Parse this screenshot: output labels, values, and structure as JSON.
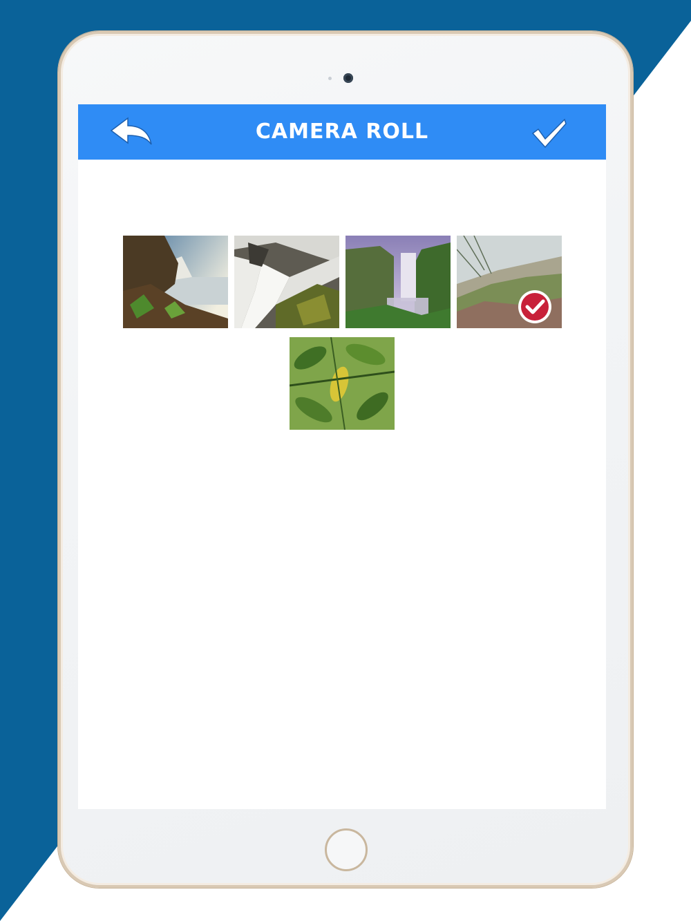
{
  "colors": {
    "background_accent": "#0a6299",
    "topbar": "#2f8cf5",
    "title_text": "#ffffff",
    "device_frame": "#d9c9b4",
    "selected_badge": "#c8213a"
  },
  "header": {
    "title": "CAMERA ROLL",
    "back_icon": "back-arrow-icon",
    "done_icon": "checkmark-icon"
  },
  "photos": [
    {
      "subject": "waterfall-cliff",
      "selected": false
    },
    {
      "subject": "waterfall-rapids",
      "selected": false
    },
    {
      "subject": "waterfall-misty-valley",
      "selected": false
    },
    {
      "subject": "dune-grass",
      "selected": true
    },
    {
      "subject": "green-leaves",
      "selected": false
    }
  ]
}
